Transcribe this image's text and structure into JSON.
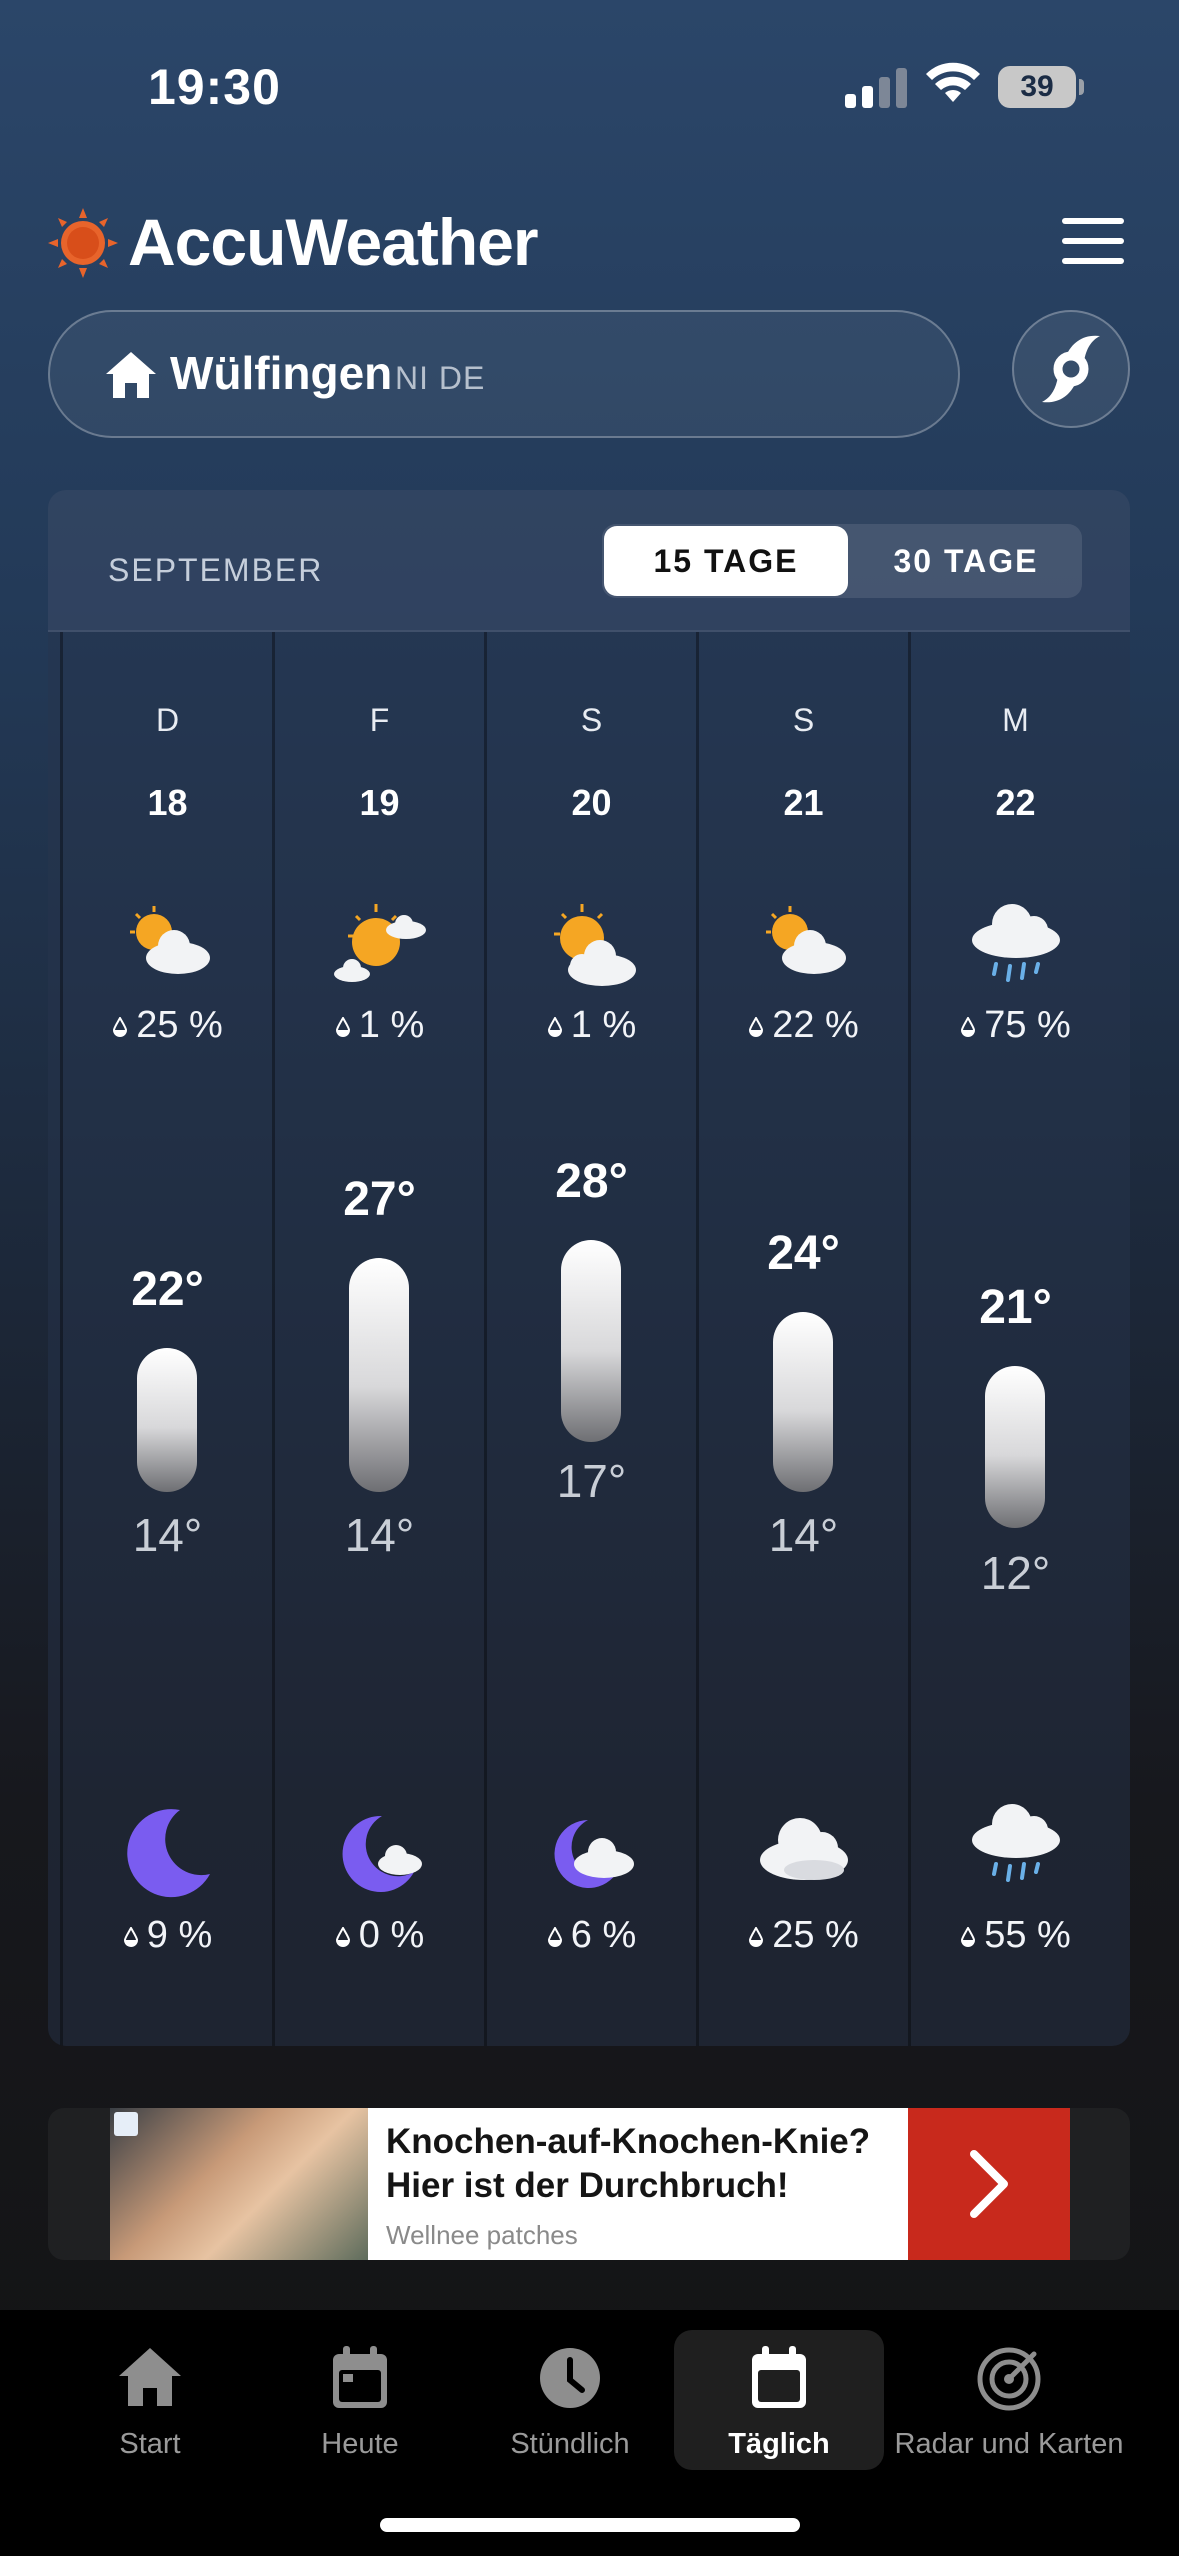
{
  "status_bar": {
    "time": "19:30",
    "battery": "39"
  },
  "header": {
    "brand": "AccuWeather",
    "menu_icon": "hamburger-menu-icon"
  },
  "location": {
    "name": "Wülfingen",
    "region": "NI DE",
    "home_icon": "home-icon",
    "storm_icon": "hurricane-icon"
  },
  "forecast": {
    "month": "SEPTEMBER",
    "range_options": [
      "15 TAGE",
      "30 TAGE"
    ],
    "selected_range": "15 TAGE",
    "days": [
      {
        "dow": "D",
        "date": "18",
        "day_icon": "partly-sunny-icon",
        "day_precip": "25 %",
        "high": "22°",
        "low": "14°",
        "night_icon": "moon-icon",
        "night_precip": "9 %"
      },
      {
        "dow": "F",
        "date": "19",
        "day_icon": "mostly-sunny-icon",
        "day_precip": "1 %",
        "high": "27°",
        "low": "14°",
        "night_icon": "moon-cloud-icon",
        "night_precip": "0 %"
      },
      {
        "dow": "S",
        "date": "20",
        "day_icon": "sun-cloud-icon",
        "day_precip": "1 %",
        "high": "28°",
        "low": "17°",
        "night_icon": "moon-cloud-icon",
        "night_precip": "6 %"
      },
      {
        "dow": "S",
        "date": "21",
        "day_icon": "partly-sunny-icon",
        "day_precip": "22 %",
        "high": "24°",
        "low": "14°",
        "night_icon": "cloudy-icon",
        "night_precip": "25 %"
      },
      {
        "dow": "M",
        "date": "22",
        "day_icon": "rain-icon",
        "day_precip": "75 %",
        "high": "21°",
        "low": "12°",
        "night_icon": "rain-icon",
        "night_precip": "55 %"
      }
    ]
  },
  "ad": {
    "title": "Knochen-auf-Knochen-Knie? Hier ist der Durchbruch!",
    "advertiser": "Wellnee patches",
    "arrow_icon": "chevron-right-icon"
  },
  "tabs": [
    {
      "label": "Start",
      "icon": "home-icon"
    },
    {
      "label": "Heute",
      "icon": "calendar-icon"
    },
    {
      "label": "Stündlich",
      "icon": "clock-icon"
    },
    {
      "label": "Täglich",
      "icon": "calendar-icon",
      "active": true
    },
    {
      "label": "Radar und Karten",
      "icon": "radar-icon"
    }
  ],
  "colors": {
    "brand_orange": "#e8642b",
    "ad_red": "#c8291c",
    "moon_purple": "#7a5cf0"
  }
}
